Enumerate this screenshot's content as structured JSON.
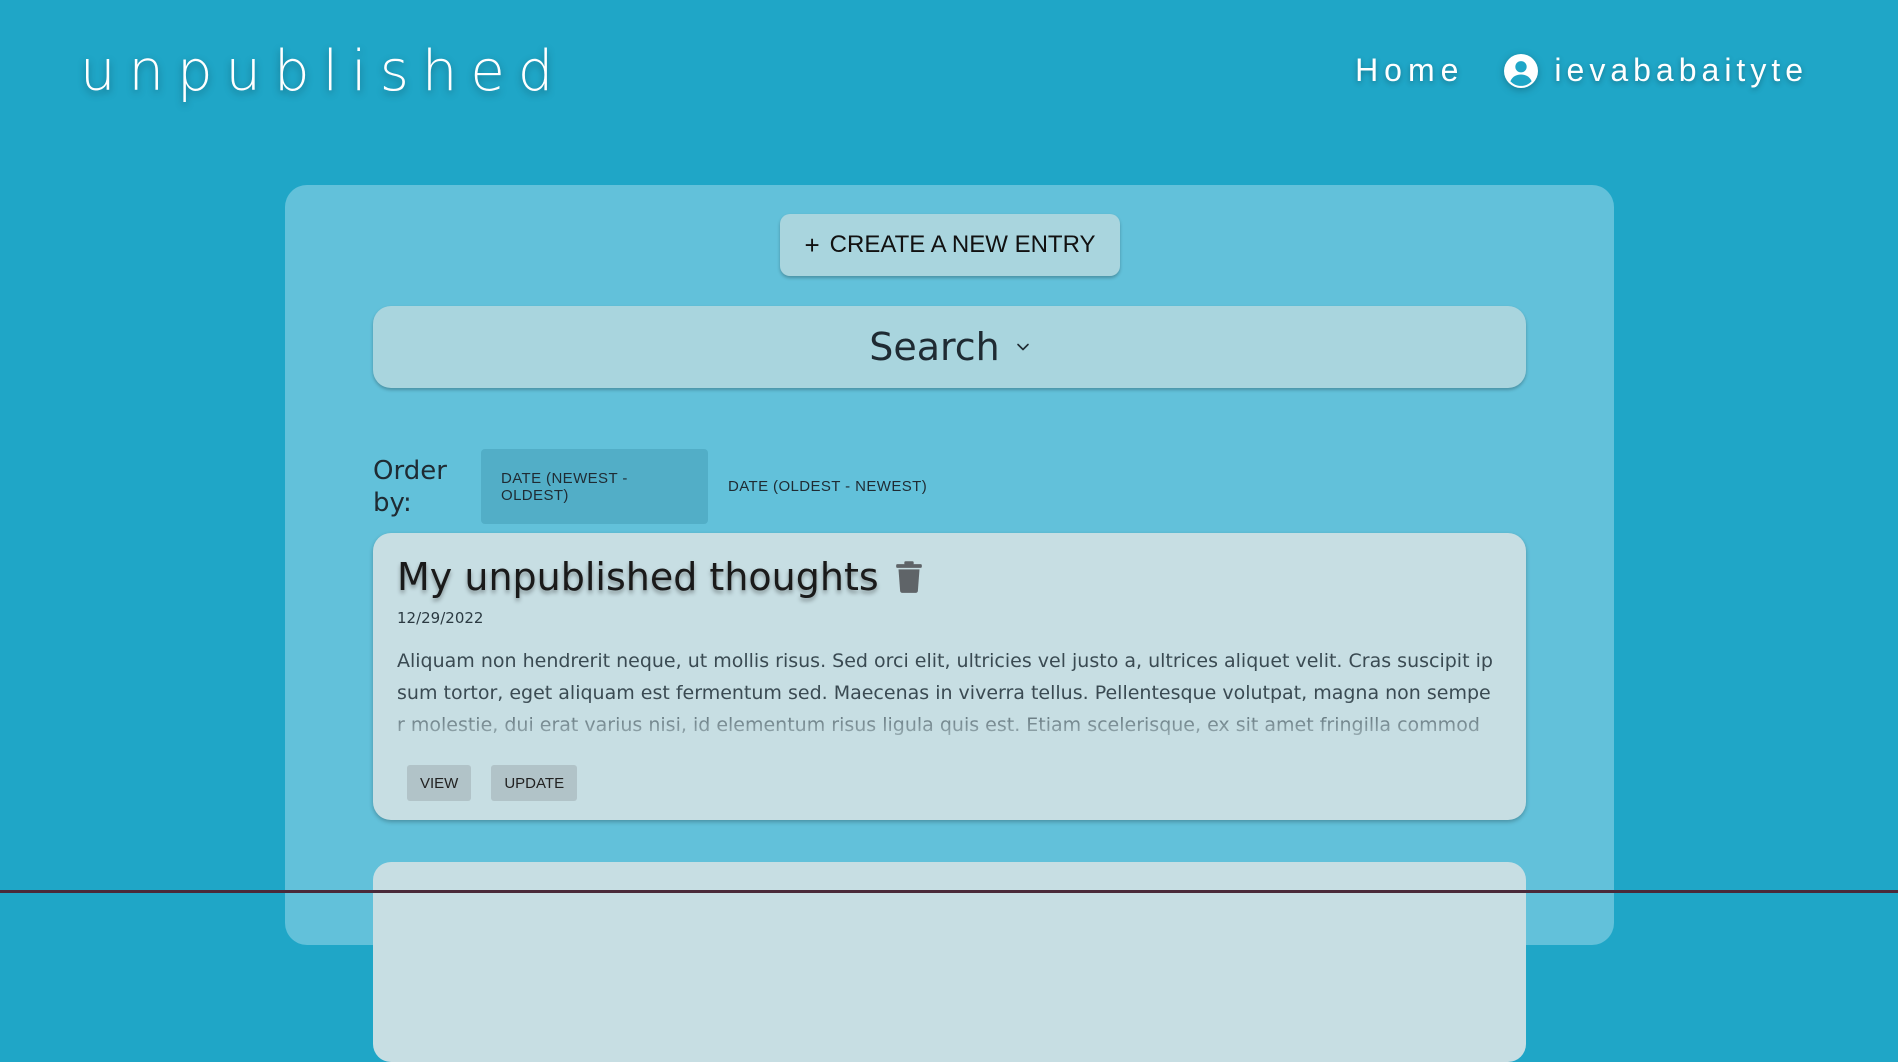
{
  "header": {
    "logo": "unpublished",
    "nav_home": "Home",
    "username": "ievababaityte"
  },
  "toolbar": {
    "create_plus": "+",
    "create_label": "CREATE A NEW ENTRY"
  },
  "search": {
    "label": "Search"
  },
  "order": {
    "label": "Order by:",
    "options": [
      {
        "label": "DATE (NEWEST - OLDEST)",
        "active": true
      },
      {
        "label": "DATE (OLDEST - NEWEST)",
        "active": false
      }
    ]
  },
  "entries": [
    {
      "title": "My unpublished thoughts",
      "date": "12/29/2022",
      "body": "Aliquam non hendrerit neque, ut mollis risus. Sed orci elit, ultricies vel justo a, ultrices aliquet velit. Cras suscipit ipsum tortor, eget aliquam est fermentum sed. Maecenas in viverra tellus. Pellentesque volutpat, magna non semper molestie, dui erat varius nisi, id elementum risus ligula quis est. Etiam scelerisque, ex sit amet fringilla commodo, ligula lorem frin",
      "view_label": "VIEW",
      "update_label": "UPDATE"
    }
  ],
  "colors": {
    "background": "#1fa6c7",
    "panel": "#62c1da",
    "card": "#c7dee3",
    "button": "#a9d5de",
    "active_order": "#52aec7"
  },
  "icons": {
    "user": "account-circle-icon",
    "chevron": "chevron-down-icon",
    "delete": "trash-icon"
  }
}
